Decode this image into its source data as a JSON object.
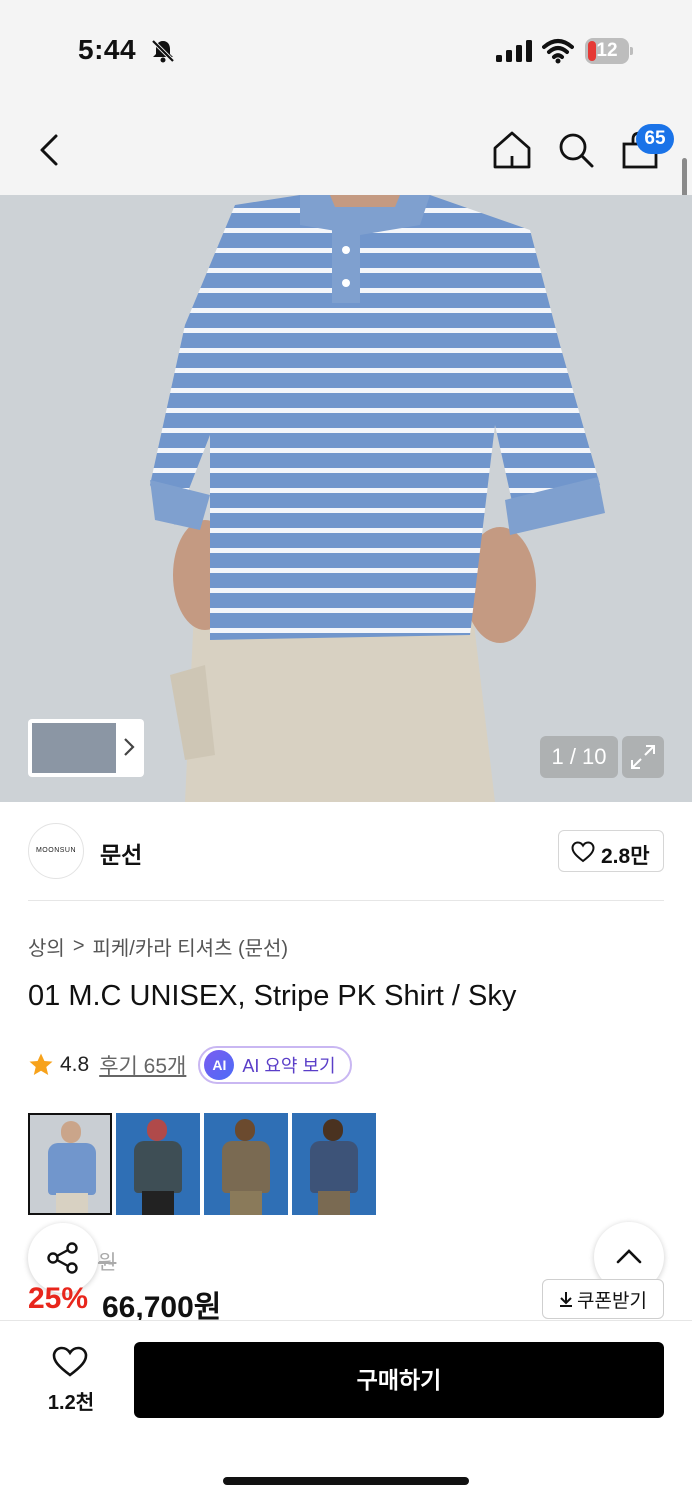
{
  "status_bar": {
    "time": "5:44",
    "battery": "12"
  },
  "header": {
    "cart_count": "65"
  },
  "gallery": {
    "counter": "1 / 10"
  },
  "brand": {
    "logo_text": "MOONSUN",
    "name": "문선",
    "likes": "2.8만"
  },
  "breadcrumb": {
    "category": "상의",
    "separator": ">",
    "subcategory": "피케/카라 티셔츠 (문선)"
  },
  "product": {
    "title": "01 M.C UNISEX, Stripe PK Shirt / Sky",
    "rating": "4.8",
    "reviews": "후기 65개",
    "ai_badge": "AI",
    "ai_summary": "AI 요약 보기"
  },
  "color_options": [
    {
      "color": "#6f8fbe"
    },
    {
      "color": "#3e4e55"
    },
    {
      "color": "#7a6a52"
    },
    {
      "color": "#3d5378"
    }
  ],
  "price": {
    "original_suffix": "원",
    "discount": "25%",
    "sale": "66,700원",
    "coupon": "쿠폰받기"
  },
  "bottom_bar": {
    "wish_count": "1.2천",
    "buy": "구매하기"
  },
  "colors": {
    "accent_blue": "#1a73e8",
    "discount_red": "#e8261c",
    "ai_purple": "#5a3ec8"
  }
}
